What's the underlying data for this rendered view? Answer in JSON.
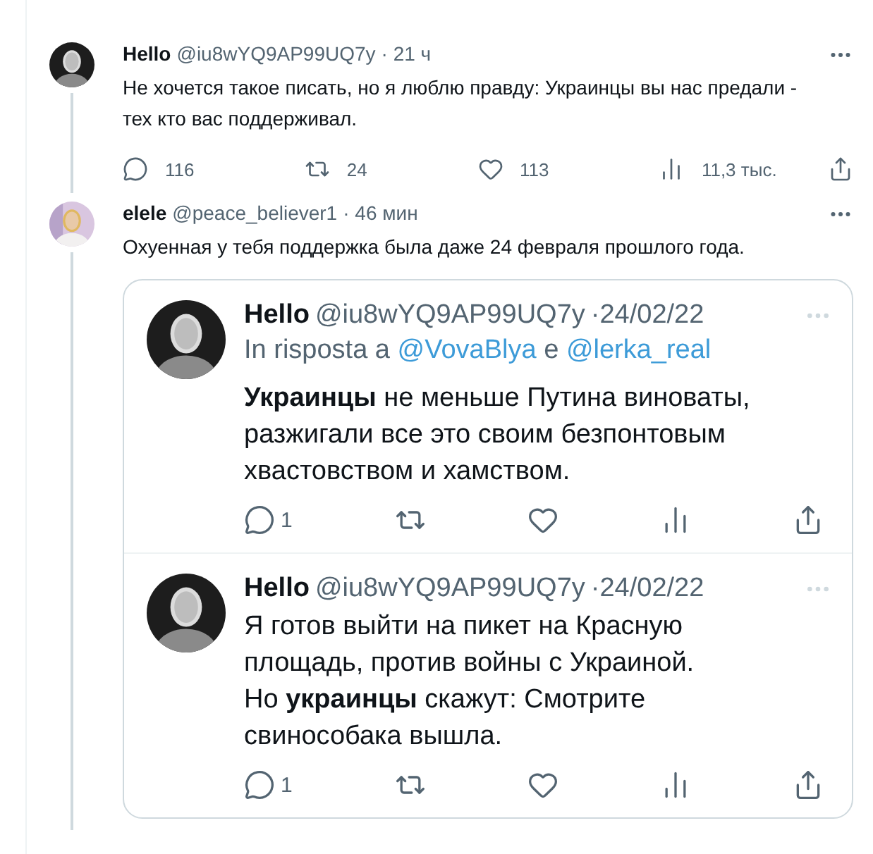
{
  "tweets": [
    {
      "name": "Hello",
      "handle": "@iu8wYQ9AP99UQ7y",
      "time": "· 21 ч",
      "text": "Не хочется такое писать, но я люблю правду: Украинцы вы нас предали -\nтех кто вас поддерживал.",
      "actions": [
        {
          "kind": "reply",
          "count": "116"
        },
        {
          "kind": "retweet",
          "count": "24"
        },
        {
          "kind": "like",
          "count": "113"
        },
        {
          "kind": "views",
          "count": "11,3 тыс."
        },
        {
          "kind": "share"
        }
      ]
    },
    {
      "name": "elele",
      "handle": "@peace_believer1",
      "time": "· 46 мин",
      "text": "Охуенная у тебя поддержка была даже 24 февраля прошлого года.",
      "quote": [
        {
          "name": "Hello",
          "handle": "@iu8wYQ9AP99UQ7y",
          "time": "·24/02/22",
          "reply_to": {
            "prefix": "In risposta a",
            "users": [
              "@VovaBlya",
              "@lerka_real"
            ],
            "joiner": "e"
          },
          "text": "**Украинцы** не меньше Путина виноваты,\nразжигали все это своим безпонтовым\nхвастовством и хамством.",
          "actions": [
            {
              "kind": "reply",
              "count": "1"
            },
            {
              "kind": "retweet"
            },
            {
              "kind": "like"
            },
            {
              "kind": "views"
            },
            {
              "kind": "share"
            }
          ]
        },
        {
          "name": "Hello",
          "handle": "@iu8wYQ9AP99UQ7y",
          "time": "·24/02/22",
          "text": "Я готов выйти на пикет на Красную\nплощадь, против войны с Украиной.\nНо **украинцы** скажут: Смотрите\nсвинособака вышла.",
          "actions": [
            {
              "kind": "reply",
              "count": "1"
            },
            {
              "kind": "retweet"
            },
            {
              "kind": "like"
            },
            {
              "kind": "views"
            },
            {
              "kind": "share"
            }
          ]
        }
      ]
    }
  ]
}
